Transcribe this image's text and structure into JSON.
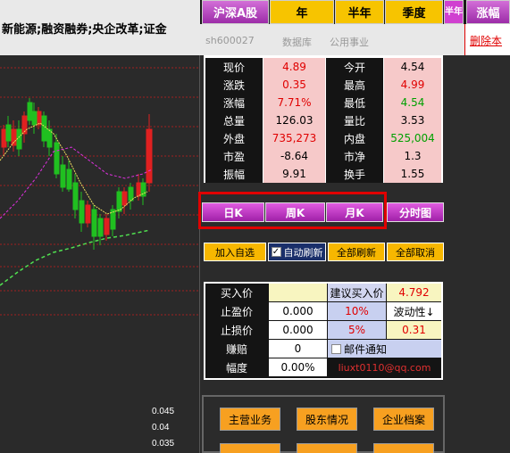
{
  "headline": "新能源;融资融券;央企改革;证金",
  "chart": {
    "y_labels": [
      "0.045",
      "0.04",
      "0.035"
    ]
  },
  "tabs": {
    "market": "沪深A股",
    "year": "年",
    "half_year": "半年",
    "quarter": "季度",
    "half_year_short": "半年",
    "range": "涨幅"
  },
  "info": {
    "code": "sh600027",
    "item2": "数据库",
    "item3": "公用事业",
    "delete_link": "删除本"
  },
  "quote": [
    {
      "l1": "现价",
      "v1": "4.89",
      "c1": "#e00000",
      "l2": "今开",
      "v2": "4.54",
      "c2": "#000000"
    },
    {
      "l1": "涨跌",
      "v1": "0.35",
      "c1": "#e00000",
      "l2": "最高",
      "v2": "4.99",
      "c2": "#e00000"
    },
    {
      "l1": "涨幅",
      "v1": "7.71%",
      "c1": "#e00000",
      "l2": "最低",
      "v2": "4.54",
      "c2": "#00a000"
    },
    {
      "l1": "总量",
      "v1": "126.03",
      "c1": "#000000",
      "l2": "量比",
      "v2": "3.53",
      "c2": "#000000"
    },
    {
      "l1": "外盘",
      "v1": "735,273",
      "c1": "#e00000",
      "l2": "内盘",
      "v2": "525,004",
      "c2": "#00a000"
    },
    {
      "l1": "市盈",
      "v1": "-8.64",
      "c1": "#000000",
      "l2": "市净",
      "v2": "1.3",
      "c2": "#000000"
    },
    {
      "l1": "振幅",
      "v1": "9.91",
      "c1": "#000000",
      "l2": "换手",
      "v2": "1.55",
      "c2": "#000000"
    }
  ],
  "kbuttons": {
    "day": "日K",
    "week": "周K",
    "month": "月K",
    "timeshare": "分时图"
  },
  "actions": {
    "add_watch": "加入自选",
    "auto_refresh": "自动刷新",
    "refresh_all": "全部刷新",
    "cancel_all": "全部取消"
  },
  "trade": {
    "buy_label": "买入价",
    "suggest_label": "建议买入价",
    "suggest_value": "4.792",
    "tp_label": "止盈价",
    "tp_value": "0.000",
    "tp_pct": "10%",
    "volatility": "波动性↓",
    "sl_label": "止损价",
    "sl_value": "0.000",
    "sl_pct": "5%",
    "vol_value": "0.31",
    "pnl_label": "赚赔",
    "pnl_value": "0",
    "email_notify": "邮件通知",
    "range_label": "幅度",
    "range_value": "0.00%",
    "email": "liuxt0110@qq.com"
  },
  "bottom": {
    "main_business": "主营业务",
    "shareholders": "股东情况",
    "company_profile": "企业档案"
  }
}
